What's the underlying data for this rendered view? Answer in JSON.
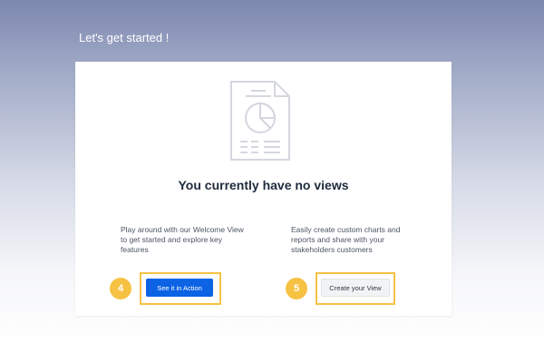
{
  "page": {
    "title": "Let's get started !"
  },
  "card": {
    "illustration_icon": "report-chart-document-icon",
    "heading": "You currently have no views",
    "left_column": {
      "description": "Play around with our Welcome View to get started and explore key features",
      "button_label": "See it in Action",
      "callout_number": "4"
    },
    "right_column": {
      "description": "Easily create custom charts and reports and share with your stakeholders customers",
      "button_label": "Create your View",
      "callout_number": "5"
    }
  },
  "colors": {
    "primary_button": "#0c63e4",
    "callout_highlight": "#f6c244",
    "heading_text": "#1f2b3d"
  }
}
